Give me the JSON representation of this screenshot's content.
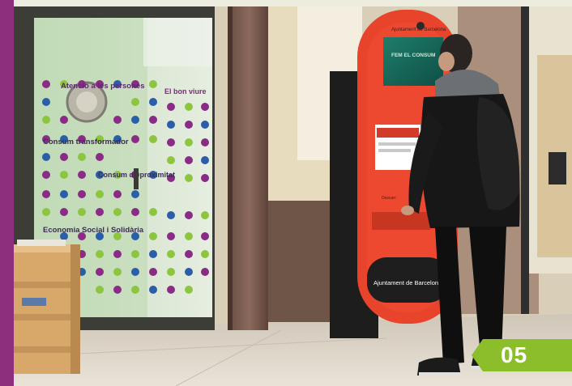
{
  "photo": {
    "window_lines": [
      "El bon viure",
      "Atenció a les persones",
      "Consum transformador",
      "Consum de proximitat",
      "Economia Social i Solidària"
    ],
    "kiosk_brand": "Ajuntament de Barcelona",
    "kiosk_screen_text": "FEM EL CONSUM"
  },
  "badge": {
    "number": "05",
    "color": "#8cbd2a"
  },
  "colors": {
    "side_bar": "#8e2f7e",
    "kiosk": "#e8432b",
    "dot_purple": "#8a2b85",
    "dot_blue": "#2b5ea8",
    "dot_green": "#8cc63f"
  }
}
